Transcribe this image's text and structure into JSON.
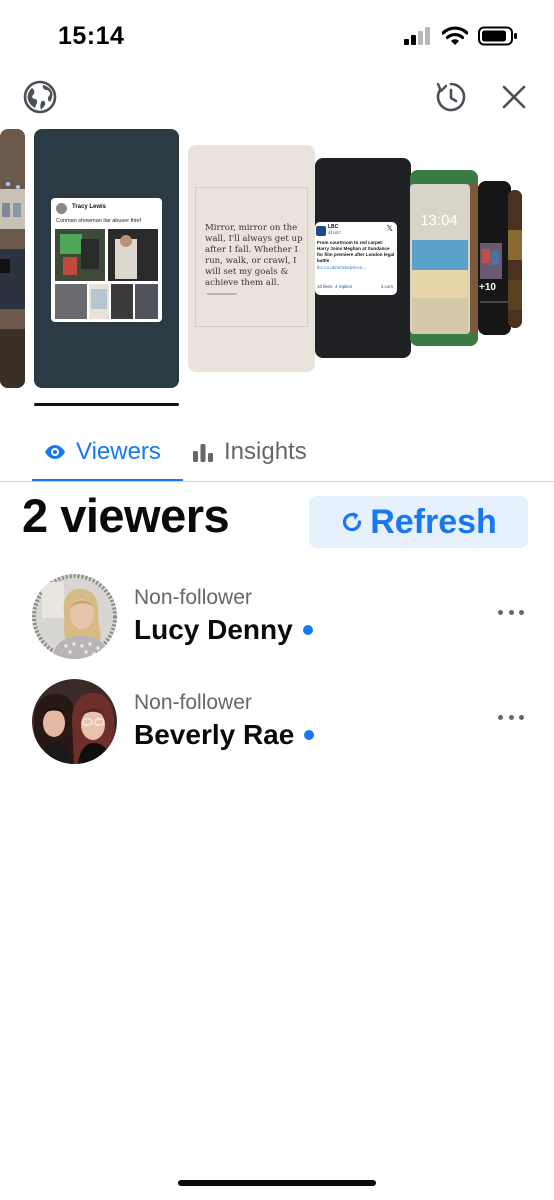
{
  "status_bar": {
    "time": "15:14"
  },
  "header": {
    "globe_icon": "globe-icon",
    "timer_icon": "timer-icon",
    "close_icon": "close-icon"
  },
  "stories": {
    "story1": {
      "author": "Tracy Lewis",
      "caption": "Conman showman liar abuser thief"
    },
    "story2": {
      "quote": "Mirror, mirror on the wall, I'll always get up after I fall. Whether I run, walk, or crawl, I will set my goals & achieve them all."
    },
    "story3": {
      "account": "LBC",
      "handle": "@LBC",
      "headline": "From courtroom to red carpet: Harry Joins Meghan at Sundance for film premiere after London legal battle",
      "link": "lbc.co.uk/article/prince...",
      "likes": "10 likes",
      "replies": "4 replies",
      "domain": "s.com"
    },
    "story4": {
      "time": "13:04"
    },
    "story5": {
      "badge": "+10"
    }
  },
  "tabs": [
    {
      "label": "Viewers",
      "icon": "eye-icon",
      "active": true
    },
    {
      "label": "Insights",
      "icon": "bar-chart-icon",
      "active": false
    }
  ],
  "viewers_count": "2 viewers",
  "refresh_label": "Refresh",
  "viewers": [
    {
      "status": "Non-follower",
      "name": "Lucy Denny",
      "online": true
    },
    {
      "status": "Non-follower",
      "name": "Beverly Rae",
      "online": true
    }
  ],
  "colors": {
    "accent": "#1877f2",
    "muted": "#65676b",
    "refresh_bg": "#e7f0fd"
  }
}
